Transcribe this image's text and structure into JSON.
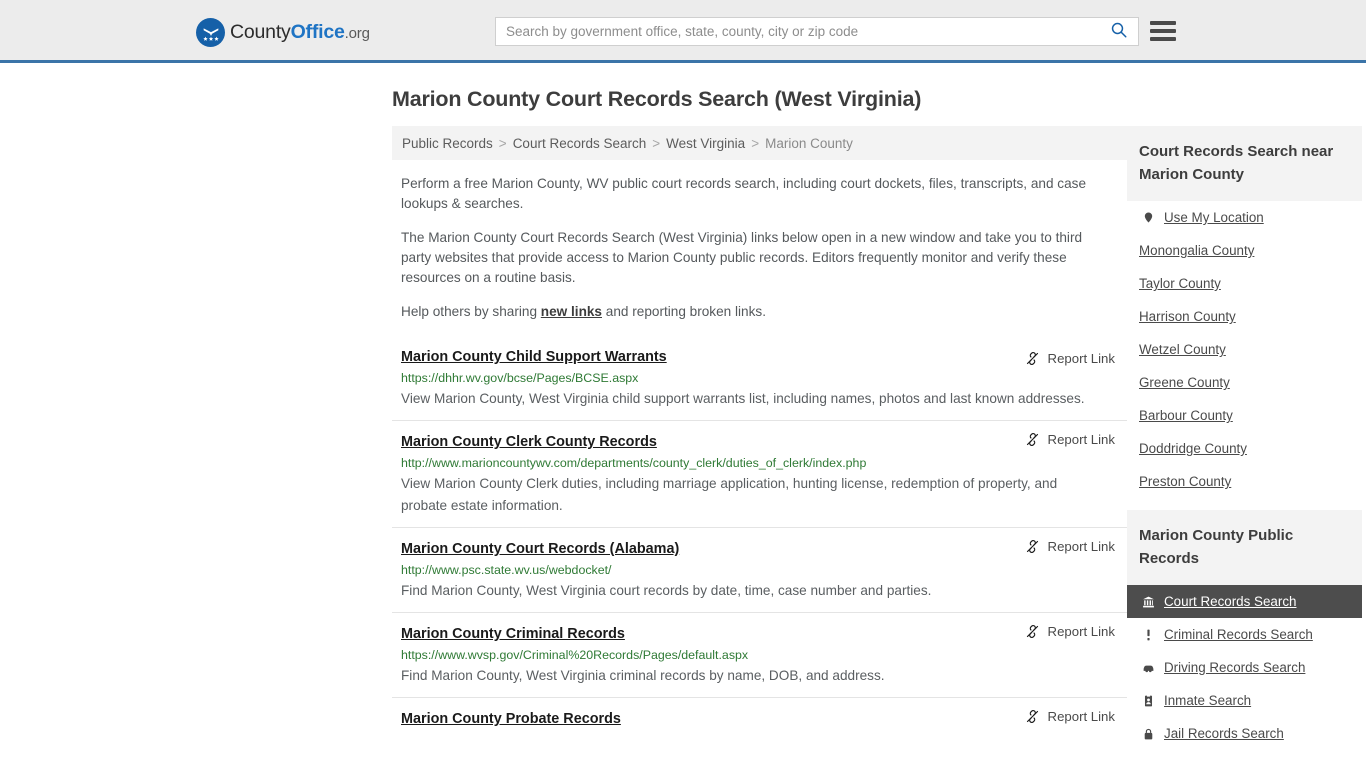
{
  "header": {
    "logo": {
      "icon": "eagle-shield-logo-icon",
      "text_county": "County",
      "text_office": "Office",
      "text_org": ".org"
    },
    "search": {
      "placeholder": "Search by government office, state, county, city or zip code",
      "value": "",
      "button_icon": "search-icon"
    },
    "menu_icon": "hamburger-menu-icon"
  },
  "page": {
    "title": "Marion County Court Records Search (West Virginia)"
  },
  "breadcrumb": {
    "items": [
      {
        "label": "Public Records",
        "current": false
      },
      {
        "label": "Court Records Search",
        "current": false
      },
      {
        "label": "West Virginia",
        "current": false
      },
      {
        "label": "Marion County",
        "current": true
      }
    ],
    "separator": ">"
  },
  "intro": {
    "paragraph1": "Perform a free Marion County, WV public court records search, including court dockets, files, transcripts, and case lookups & searches.",
    "paragraph2": "The Marion County Court Records Search (West Virginia) links below open in a new window and take you to third party websites that provide access to Marion County public records. Editors frequently monitor and verify these resources on a routine basis.",
    "paragraph3_before": "Help others by sharing ",
    "paragraph3_link": "new links",
    "paragraph3_after": " and reporting broken links."
  },
  "report_link": {
    "label": "Report Link",
    "icon": "broken-link-icon"
  },
  "results": [
    {
      "title": "Marion County Child Support Warrants",
      "url": "https://dhhr.wv.gov/bcse/Pages/BCSE.aspx",
      "description": "View Marion County, West Virginia child support warrants list, including names, photos and last known addresses."
    },
    {
      "title": "Marion County Clerk County Records",
      "url": "http://www.marioncountywv.com/departments/county_clerk/duties_of_clerk/index.php",
      "description": "View Marion County Clerk duties, including marriage application, hunting license, redemption of property, and probate estate information."
    },
    {
      "title": "Marion County Court Records (Alabama)",
      "url": "http://www.psc.state.wv.us/webdocket/",
      "description": "Find Marion County, West Virginia court records by date, time, case number and parties."
    },
    {
      "title": "Marion County Criminal Records",
      "url": "https://www.wvsp.gov/Criminal%20Records/Pages/default.aspx",
      "description": "Find Marion County, West Virginia criminal records by name, DOB, and address."
    },
    {
      "title": "Marion County Probate Records",
      "url": "",
      "description": ""
    }
  ],
  "sidebar": {
    "nearby": {
      "heading": "Court Records Search near Marion County",
      "items": [
        {
          "label": "Use My Location",
          "icon": "map-pin-icon"
        },
        {
          "label": "Monongalia County",
          "icon": ""
        },
        {
          "label": "Taylor County",
          "icon": ""
        },
        {
          "label": "Harrison County",
          "icon": ""
        },
        {
          "label": "Wetzel County",
          "icon": ""
        },
        {
          "label": "Greene County",
          "icon": ""
        },
        {
          "label": "Barbour County",
          "icon": ""
        },
        {
          "label": "Doddridge County",
          "icon": ""
        },
        {
          "label": "Preston County",
          "icon": ""
        }
      ]
    },
    "public_records": {
      "heading": "Marion County Public Records",
      "items": [
        {
          "label": "Court Records Search",
          "icon": "courthouse-icon",
          "active": true
        },
        {
          "label": "Criminal Records Search",
          "icon": "exclamation-icon",
          "active": false
        },
        {
          "label": "Driving Records Search",
          "icon": "car-icon",
          "active": false
        },
        {
          "label": "Inmate Search",
          "icon": "id-badge-icon",
          "active": false
        },
        {
          "label": "Jail Records Search",
          "icon": "lock-icon",
          "active": false
        }
      ]
    }
  },
  "colors": {
    "header_bg": "#ececec",
    "header_border": "#3b74a8",
    "brand_blue": "#1560a8",
    "link_green": "#2f7a35",
    "active_bg": "#4d4d4d",
    "panel_bg": "#f3f3f3"
  }
}
